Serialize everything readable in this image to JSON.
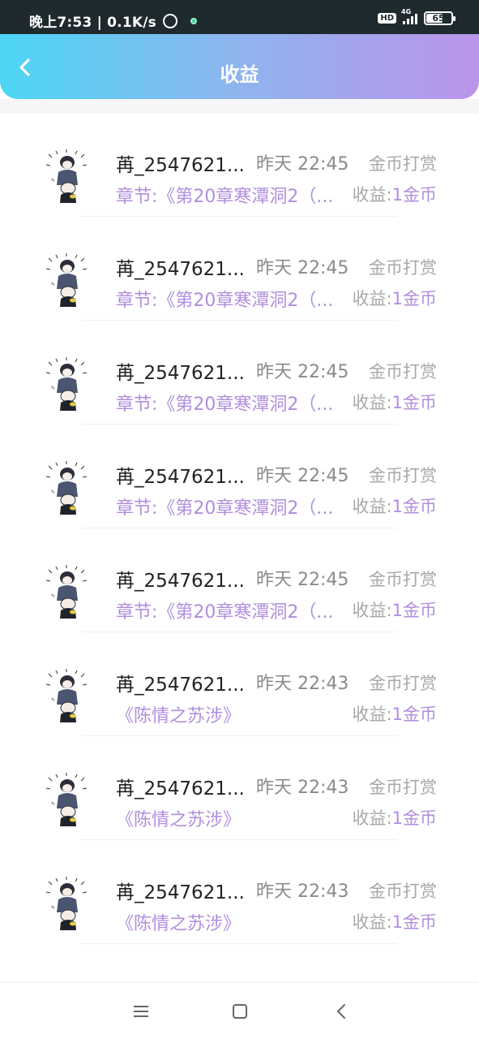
{
  "status_bar": {
    "time_speed": "晚上7:53 | 0.1K/s",
    "hd": "HD",
    "network": "4G",
    "battery": "65"
  },
  "header": {
    "title": "收益",
    "back_icon": "chevron-left-icon"
  },
  "labels": {
    "earn_label": "收益:",
    "earn_amount": "1金币",
    "type": "金币打赏"
  },
  "items": [
    {
      "name": "苒_2547621...",
      "time": "昨天 22:45",
      "type": "金币打赏",
      "chapter": "章节:《第20章寒潭洞2（...",
      "earn_label": "收益:",
      "earn_amount": "1金币"
    },
    {
      "name": "苒_2547621...",
      "time": "昨天 22:45",
      "type": "金币打赏",
      "chapter": "章节:《第20章寒潭洞2（...",
      "earn_label": "收益:",
      "earn_amount": "1金币"
    },
    {
      "name": "苒_2547621...",
      "time": "昨天 22:45",
      "type": "金币打赏",
      "chapter": "章节:《第20章寒潭洞2（...",
      "earn_label": "收益:",
      "earn_amount": "1金币"
    },
    {
      "name": "苒_2547621...",
      "time": "昨天 22:45",
      "type": "金币打赏",
      "chapter": "章节:《第20章寒潭洞2（...",
      "earn_label": "收益:",
      "earn_amount": "1金币"
    },
    {
      "name": "苒_2547621...",
      "time": "昨天 22:45",
      "type": "金币打赏",
      "chapter": "章节:《第20章寒潭洞2（...",
      "earn_label": "收益:",
      "earn_amount": "1金币"
    },
    {
      "name": "苒_2547621...",
      "time": "昨天 22:43",
      "type": "金币打赏",
      "chapter": "《陈情之苏涉》",
      "earn_label": "收益:",
      "earn_amount": "1金币"
    },
    {
      "name": "苒_2547621...",
      "time": "昨天 22:43",
      "type": "金币打赏",
      "chapter": "《陈情之苏涉》",
      "earn_label": "收益:",
      "earn_amount": "1金币"
    },
    {
      "name": "苒_2547621...",
      "time": "昨天 22:43",
      "type": "金币打赏",
      "chapter": "《陈情之苏涉》",
      "earn_label": "收益:",
      "earn_amount": "1金币"
    }
  ],
  "nav": {
    "menu_icon": "menu-icon",
    "home_icon": "home-square-icon",
    "back_icon": "back-chevron-icon"
  },
  "colors": {
    "accent_purple": "#b08ede",
    "header_start": "#4cd6f5",
    "header_end": "#bb94ea"
  }
}
